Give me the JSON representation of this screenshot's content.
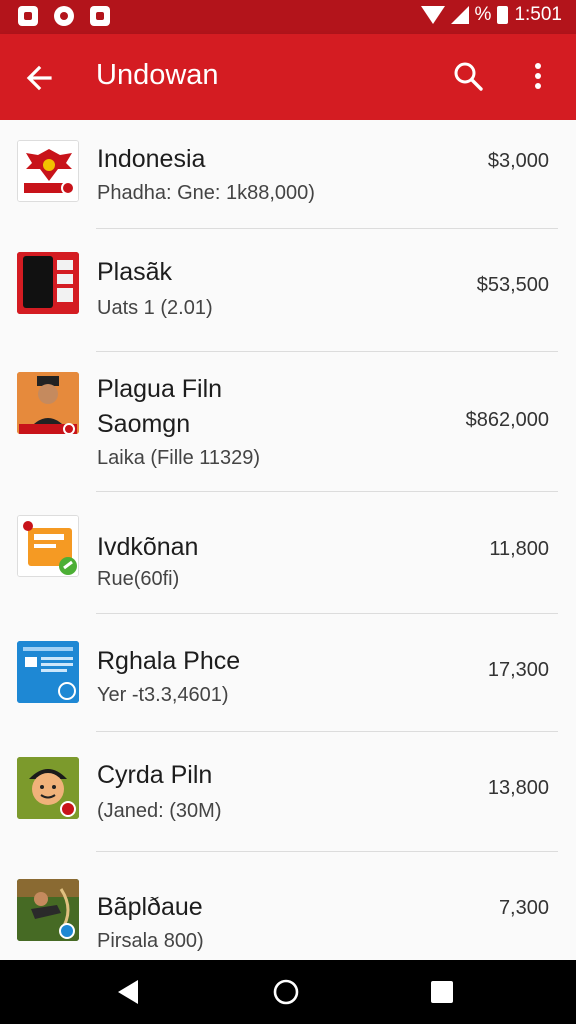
{
  "status_bar": {
    "time": "1:501",
    "battery_text": "%"
  },
  "app_bar": {
    "title": "Undowan",
    "back_icon": "arrow-back-icon",
    "search_icon": "search-icon",
    "more_icon": "more-vert-icon"
  },
  "colors": {
    "primary": "#d41c22",
    "status": "#b3141b"
  },
  "items": [
    {
      "name_line1": "Indonesia",
      "name_line2": "",
      "sub": "Phadha: Gne: 1k88,000)",
      "price": "$3,000",
      "thumb_icon": "garuda-emblem-icon"
    },
    {
      "name_line1": "Plasãk",
      "name_line2": "",
      "sub": "Uats 1 (2.01)",
      "price": "$53,500",
      "thumb_icon": "phone-device-icon"
    },
    {
      "name_line1": "Plagua Filn",
      "name_line2": "Saomgn",
      "sub": "Laika (Fille 11329)",
      "price": "$862,000",
      "thumb_icon": "person-portrait-icon"
    },
    {
      "name_line1": "Ivdkõnan",
      "name_line2": "",
      "sub": "Rue(60fi)",
      "price": "11,800",
      "thumb_icon": "orange-app-icon"
    },
    {
      "name_line1": "Rghala Phce",
      "name_line2": "",
      "sub": "Yer -t3.3,4601)",
      "price": "17,300",
      "thumb_icon": "blue-app-icon"
    },
    {
      "name_line1": "Cyrda Piln",
      "name_line2": "",
      "sub": "(Janed: (30M)",
      "price": "13,800",
      "thumb_icon": "cartoon-face-icon"
    },
    {
      "name_line1": "Bãplðaue",
      "name_line2": "",
      "sub": "Pirsala 800)",
      "price": "7,300",
      "thumb_icon": "archer-figure-icon"
    }
  ],
  "nav_bar": {
    "back_icon": "nav-back-icon",
    "home_icon": "nav-home-icon",
    "recents_icon": "nav-recents-icon"
  }
}
